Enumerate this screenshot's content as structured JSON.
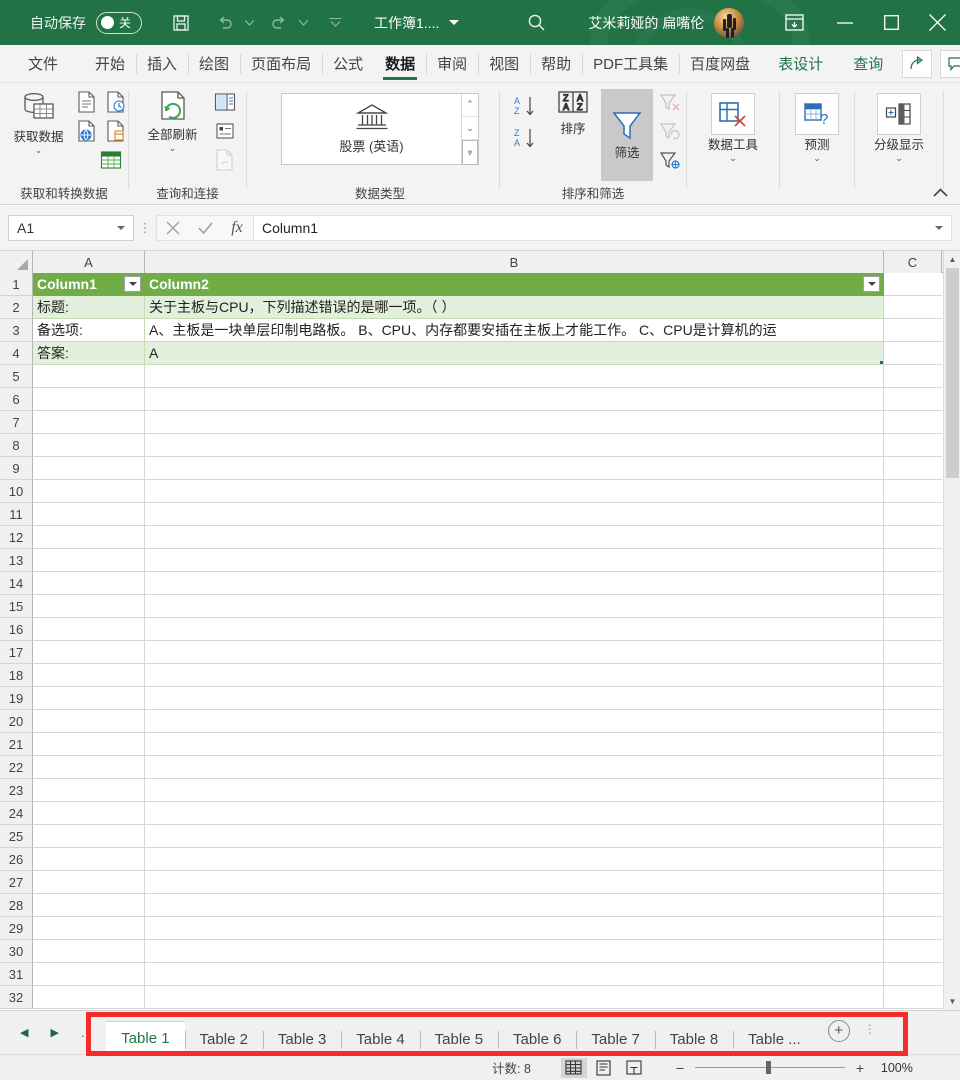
{
  "titlebar": {
    "autosave_label": "自动保存",
    "autosave_state": "关",
    "save_icon": "save-icon",
    "undo_icon": "undo-icon",
    "redo_icon": "redo-icon",
    "customize_icon": "customize-quick-access-icon",
    "document_title": "工作簿1....",
    "search_icon": "search-icon",
    "user_name": "艾米莉娅的 扁嘴伦",
    "ribbon_display_icon": "ribbon-display-options-icon",
    "minimize_icon": "minimize-icon",
    "maximize_icon": "maximize-icon",
    "close_icon": "close-icon",
    "accent_color": "#217346"
  },
  "ribbon_tabs": [
    {
      "label": "文件",
      "state": "normal"
    },
    {
      "label": "开始",
      "state": "normal"
    },
    {
      "label": "插入",
      "state": "normal"
    },
    {
      "label": "绘图",
      "state": "normal"
    },
    {
      "label": "页面布局",
      "state": "normal"
    },
    {
      "label": "公式",
      "state": "normal"
    },
    {
      "label": "数据",
      "state": "active"
    },
    {
      "label": "审阅",
      "state": "normal"
    },
    {
      "label": "视图",
      "state": "normal"
    },
    {
      "label": "帮助",
      "state": "normal"
    },
    {
      "label": "PDF工具集",
      "state": "normal"
    },
    {
      "label": "百度网盘",
      "state": "normal"
    },
    {
      "label": "表设计",
      "state": "green"
    },
    {
      "label": "查询",
      "state": "green"
    }
  ],
  "ribbon_tab_buttons": {
    "share_label": "share-icon",
    "comment_label": "comment-icon"
  },
  "ribbon": {
    "groups": [
      {
        "name": "获取和转换数据",
        "main_button": "获取数据",
        "buttons": [
          "从文本/CSV",
          "自最近使用的源",
          "自网站",
          "来自表格/区域",
          "现有连接"
        ]
      },
      {
        "name": "查询和连接",
        "main_button": "全部刷新",
        "buttons": [
          "查询和连接",
          "属性",
          "编辑链接"
        ]
      },
      {
        "name": "数据类型",
        "selected_type": "股票 (英语)",
        "type_icon": "bank-building-icon"
      },
      {
        "name": "排序和筛选",
        "sort_az": "升序排序",
        "sort_za": "降序排序",
        "main_button": "排序",
        "filter_button": "筛选",
        "filter_state": "active",
        "clear": "清除",
        "reapply": "重新应用",
        "advanced": "高级"
      },
      {
        "name": "",
        "main_button": "数据工具"
      },
      {
        "name": "",
        "main_button": "预测"
      },
      {
        "name": "",
        "main_button": "分级显示"
      }
    ],
    "collapse_icon": "collapse-ribbon-icon"
  },
  "formula_bar": {
    "namebox_value": "A1",
    "cancel_icon": "cancel-icon",
    "confirm_icon": "confirm-icon",
    "function_icon": "fx",
    "formula_value": "Column1"
  },
  "grid": {
    "columns": [
      "A",
      "B",
      "C"
    ],
    "row_numbers": [
      1,
      2,
      3,
      4,
      5,
      6,
      7,
      8,
      9,
      10,
      11,
      12,
      13,
      14,
      15,
      16,
      17,
      18,
      19,
      20,
      21,
      22,
      23,
      24,
      25,
      26,
      27,
      28,
      29,
      30,
      31,
      32
    ],
    "rows": [
      {
        "style": "header",
        "a": "Column1",
        "b": "Column2",
        "c": ""
      },
      {
        "style": "banded",
        "a": "标题:",
        "b": "关于主板与CPU，下列描述错误的是哪一项。（ ）",
        "c": ""
      },
      {
        "style": "plain",
        "a": "备选项:",
        "b": "A、主板是一块单层印制电路板。 B、CPU、内存都要安插在主板上才能工作。 C、CPU是计算机的运",
        "c": ""
      },
      {
        "style": "banded",
        "a": "答案:",
        "b": "A",
        "c": ""
      }
    ],
    "table_header_color": "#70ad47",
    "table_band_color": "#e2efda",
    "filter_dropdown_icon": "filter-dropdown-icon"
  },
  "sheet_tabs": {
    "first_icon": "first-sheet-icon",
    "prev_icon": "previous-sheet-icon",
    "next_icon": "next-sheet-icon",
    "more_icon": "more-sheets-icon",
    "tabs": [
      {
        "label": "Table 1",
        "active": true
      },
      {
        "label": "Table 2",
        "active": false
      },
      {
        "label": "Table 3",
        "active": false
      },
      {
        "label": "Table 4",
        "active": false
      },
      {
        "label": "Table 5",
        "active": false
      },
      {
        "label": "Table 6",
        "active": false
      },
      {
        "label": "Table 7",
        "active": false
      },
      {
        "label": "Table 8",
        "active": false
      },
      {
        "label": "Table ...",
        "active": false
      }
    ],
    "add_sheet_label": "+",
    "highlight_color": "#f42c2c"
  },
  "status_bar": {
    "count_label": "计数: 8",
    "view_normal_icon": "normal-view-icon",
    "view_pagelayout_icon": "page-layout-view-icon",
    "view_pagebreak_icon": "page-break-preview-icon",
    "zoom_out_label": "−",
    "zoom_in_label": "+",
    "zoom_level": "100%"
  }
}
